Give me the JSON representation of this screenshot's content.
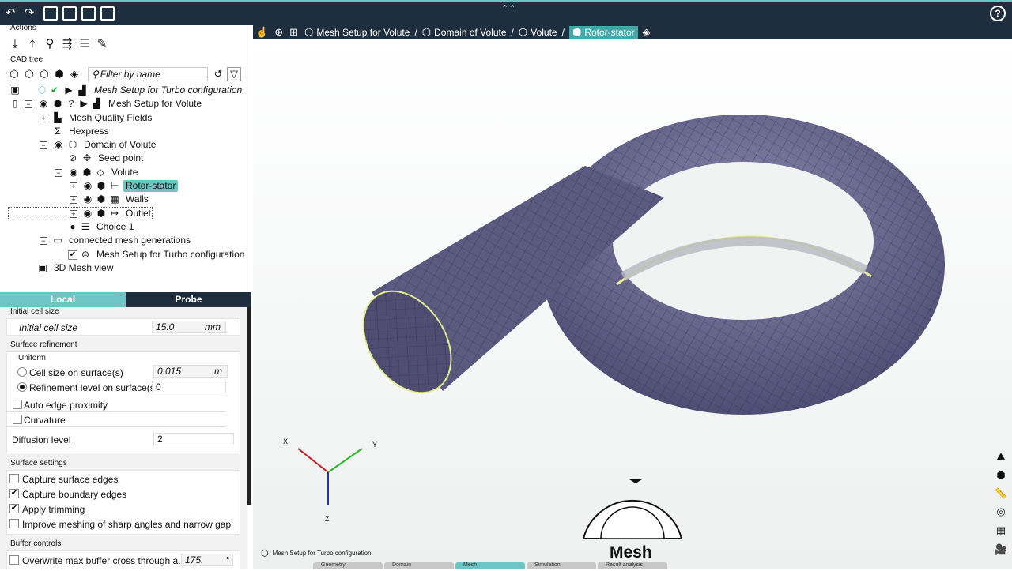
{
  "toolbar": {
    "icons": [
      "undo-icon",
      "redo-icon",
      "save-icon",
      "save-as-icon",
      "save-copy-icon",
      "layout-icon"
    ]
  },
  "actions": {
    "title": "Actions",
    "icons": [
      "import-icon",
      "export-icon",
      "node-icon",
      "flow-icon",
      "list-icon",
      "wand-icon"
    ]
  },
  "cad_tree": {
    "title": "CAD tree",
    "filter_placeholder": "Filter by name",
    "nodes": [
      {
        "label": "Mesh Setup for Turbo configuration",
        "italic": true
      },
      {
        "label": "Mesh Setup for Volute"
      },
      {
        "label": "Mesh Quality Fields"
      },
      {
        "label": "Hexpress"
      },
      {
        "label": "Domain of Volute"
      },
      {
        "label": "Seed point"
      },
      {
        "label": "Volute"
      },
      {
        "label": "Rotor-stator"
      },
      {
        "label": "Walls"
      },
      {
        "label": "Outlet"
      },
      {
        "label": "Choice 1"
      },
      {
        "label": "connected mesh generations"
      },
      {
        "label": "Mesh Setup for Turbo configuration"
      },
      {
        "label": "3D Mesh view"
      }
    ]
  },
  "tabs": {
    "local": "Local",
    "probe": "Probe"
  },
  "props": {
    "initial_cell_size": {
      "header": "Initial cell size",
      "label": "Initial cell size",
      "value": "15.0",
      "unit": "mm"
    },
    "surface_refinement": {
      "header": "Surface refinement",
      "group": "Uniform",
      "cell_size_label": "Cell size on surface(s)",
      "cell_size_value": "0.015",
      "cell_size_unit": "m",
      "level_label": "Refinement level on surface(s)",
      "level_value": "0",
      "auto_edge": "Auto edge proximity",
      "curvature": "Curvature",
      "diffusion_label": "Diffusion level",
      "diffusion_value": "2"
    },
    "surface_settings": {
      "header": "Surface settings",
      "capture_surface": "Capture surface edges",
      "capture_boundary": "Capture boundary edges",
      "apply_trimming": "Apply trimming",
      "improve_meshing": "Improve meshing of sharp angles and narrow gap"
    },
    "buffer": {
      "header": "Buffer controls",
      "overwrite": "Overwrite max buffer cross through a...",
      "value": "175.",
      "unit": "°"
    }
  },
  "breadcrumb": [
    "Mesh Setup for Volute",
    "Domain of Volute",
    "Volute",
    "Rotor-stator"
  ],
  "axes": {
    "x": "X",
    "y": "Y",
    "z": "Z"
  },
  "wheel": {
    "label": "Mesh"
  },
  "status_text": "Mesh Setup for Turbo configuration",
  "bottom_tabs": [
    "Geometry",
    "Domain",
    "Mesh",
    "Simulation",
    "Result analysis"
  ],
  "colors": {
    "dark": "#1f2e3e",
    "accent": "#6dc6c3",
    "mesh": "#5b5a80",
    "highlight": "#e8f090"
  }
}
